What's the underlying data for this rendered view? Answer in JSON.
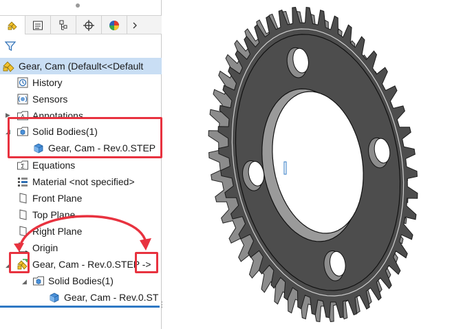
{
  "tree": {
    "root_label": "Gear, Cam  (Default<<Default",
    "items": [
      {
        "label": "History"
      },
      {
        "label": "Sensors"
      },
      {
        "label": "Annotations"
      },
      {
        "label": "Solid Bodies(1)"
      },
      {
        "label": "Gear, Cam - Rev.0.STEP"
      },
      {
        "label": "Equations"
      },
      {
        "label": "Material <not specified>"
      },
      {
        "label": "Front Plane"
      },
      {
        "label": "Top Plane"
      },
      {
        "label": "Right Plane"
      },
      {
        "label": "Origin"
      },
      {
        "label": "Gear, Cam - Rev.0.STEP ->"
      },
      {
        "label": "Solid Bodies(1)"
      },
      {
        "label": "Gear, Cam - Rev.0.ST"
      }
    ]
  },
  "icons": {
    "tabs": [
      "featuremanager-icon",
      "propertymanager-icon",
      "configurationmanager-icon",
      "dimxpert-icon",
      "display-manager-icon"
    ],
    "more": "chevron-right-icon",
    "filter": "filter-icon"
  },
  "colors": {
    "selection": "#c9def4",
    "annotation": "#e8323f",
    "gear_face": "#4d4d4d",
    "gear_highlight": "#8c8c8c",
    "scroll_accent": "#2e78c4"
  }
}
